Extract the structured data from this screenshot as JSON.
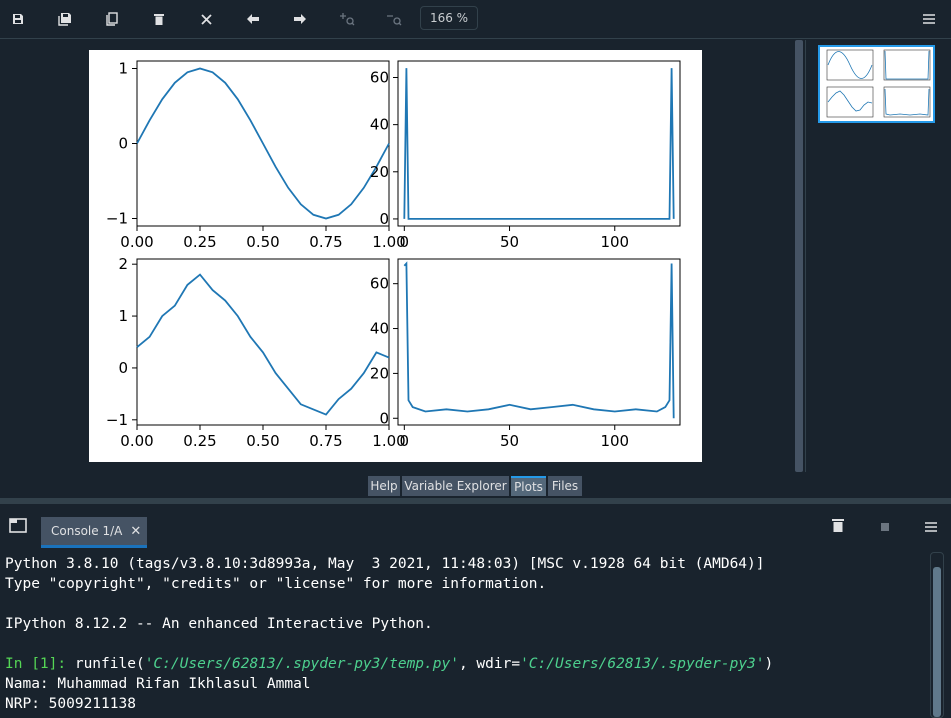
{
  "toolbar": {
    "zoom": "166 %"
  },
  "plots": {
    "chart_data": [
      {
        "type": "line",
        "series": [
          {
            "x": [
              0,
              0.05,
              0.1,
              0.15,
              0.2,
              0.25,
              0.3,
              0.35,
              0.4,
              0.45,
              0.5,
              0.55,
              0.6,
              0.65,
              0.7,
              0.75,
              0.8,
              0.85,
              0.9,
              0.95,
              1.0
            ],
            "y": [
              0,
              0.31,
              0.59,
              0.81,
              0.95,
              1,
              0.95,
              0.81,
              0.59,
              0.31,
              0,
              -0.31,
              -0.59,
              -0.81,
              -0.95,
              -1,
              -0.95,
              -0.81,
              -0.59,
              -0.31,
              0
            ]
          }
        ],
        "xlim": [
          0,
          1
        ],
        "ylim": [
          -1.1,
          1.1
        ],
        "xticks": [
          "0.00",
          "0.25",
          "0.50",
          "0.75",
          "1.00"
        ],
        "yticks": [
          "-1",
          "0",
          "1"
        ]
      },
      {
        "type": "line",
        "series": [
          {
            "x": [
              0,
              1,
              2,
              3,
              126,
              127,
              128
            ],
            "y": [
              0,
              64,
              0,
              0,
              0,
              64,
              0
            ]
          }
        ],
        "xlim": [
          -3,
          131
        ],
        "ylim": [
          -3,
          67
        ],
        "xticks": [
          "0",
          "50",
          "100"
        ],
        "yticks": [
          "0",
          "20",
          "40",
          "60"
        ]
      },
      {
        "type": "line",
        "series": [
          {
            "x": [
              0,
              0.05,
              0.1,
              0.15,
              0.2,
              0.25,
              0.3,
              0.35,
              0.4,
              0.45,
              0.5,
              0.55,
              0.6,
              0.65,
              0.7,
              0.75,
              0.8,
              0.85,
              0.9,
              0.95,
              1.0
            ],
            "y": [
              0.4,
              0.6,
              1.0,
              1.2,
              1.6,
              1.8,
              1.5,
              1.3,
              1.0,
              0.6,
              0.3,
              -0.1,
              -0.4,
              -0.7,
              -0.8,
              -0.9,
              -0.6,
              -0.4,
              -0.1,
              0.3,
              0.2
            ]
          }
        ],
        "xlim": [
          0,
          1
        ],
        "ylim": [
          -1.1,
          2.1
        ],
        "xticks": [
          "0.00",
          "0.25",
          "0.50",
          "0.75",
          "1.00"
        ],
        "yticks": [
          "-1",
          "0",
          "1",
          "2"
        ]
      },
      {
        "type": "line",
        "series": [
          {
            "x": [
              0,
              1,
              2,
              4,
              10,
              20,
              30,
              40,
              50,
              60,
              70,
              80,
              90,
              100,
              110,
              120,
              124,
              126,
              127,
              128
            ],
            "y": [
              68,
              69,
              8,
              5,
              3,
              4,
              3,
              4,
              6,
              4,
              5,
              6,
              4,
              3,
              4,
              3,
              5,
              8,
              69,
              0
            ]
          }
        ],
        "xlim": [
          -3,
          131
        ],
        "ylim": [
          -3,
          71
        ],
        "xticks": [
          "0",
          "50",
          "100"
        ],
        "yticks": [
          "0",
          "20",
          "40",
          "60"
        ]
      }
    ]
  },
  "pane_tabs": [
    "Help",
    "Variable Explorer",
    "Plots",
    "Files"
  ],
  "console": {
    "tab_label": "Console 1/A",
    "lines": {
      "l1": "Python 3.8.10 (tags/v3.8.10:3d8993a, May  3 2021, 11:48:03) [MSC v.1928 64 bit (AMD64)]",
      "l2": "Type \"copyright\", \"credits\" or \"license\" for more information.",
      "l3": "IPython 8.12.2 -- An enhanced Interactive Python.",
      "prompt": "In [1]:",
      "cmd_a": " runfile(",
      "cmd_s1": "'C:/Users/62813/.spyder-py3/temp.py'",
      "cmd_b": ", wdir=",
      "cmd_s2": "'C:/Users/62813/.spyder-py3'",
      "cmd_c": ")",
      "l5": "Nama: Muhammad Rifan Ikhlasul Ammal",
      "l6": "NRP: 5009211138"
    }
  },
  "colors": {
    "bg": "#19232d",
    "line": "#1f77b4",
    "accent": "#259ae9"
  }
}
